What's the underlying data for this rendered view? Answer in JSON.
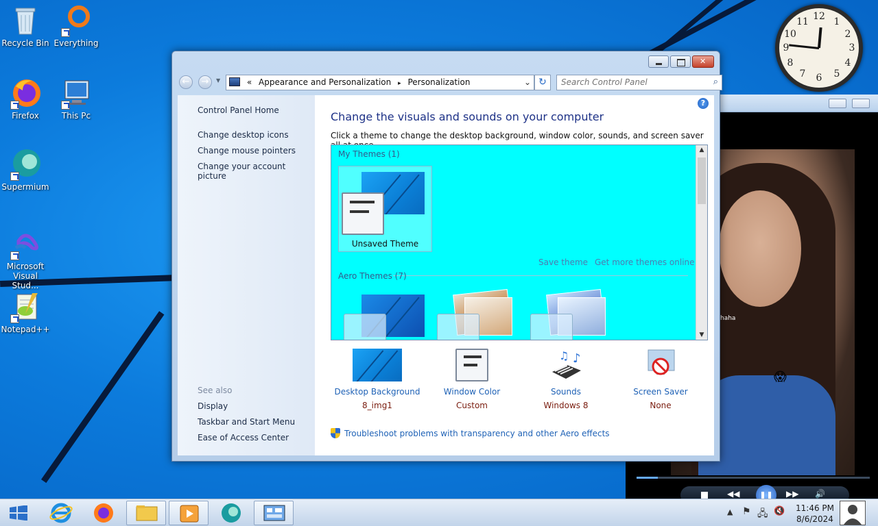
{
  "desktop": {
    "icons": [
      {
        "label": "Recycle Bin"
      },
      {
        "label": "Everything"
      },
      {
        "label": "Firefox"
      },
      {
        "label": "This Pc"
      },
      {
        "label": "Supermium"
      },
      {
        "label": "Microsoft Visual Stud..."
      },
      {
        "label": "Notepad++"
      }
    ]
  },
  "clock_gadget": {
    "numbers": [
      "12",
      "1",
      "2",
      "3",
      "4",
      "5",
      "6",
      "7",
      "8",
      "9",
      "10",
      "11"
    ]
  },
  "player": {
    "caption": "haha",
    "emoji": "😱",
    "progress_fraction": 0.09
  },
  "window": {
    "breadcrumb": {
      "prefix": "«",
      "items": [
        "Appearance and Personalization",
        "Personalization"
      ],
      "separator": "▸"
    },
    "search": {
      "placeholder": "Search Control Panel"
    },
    "left_nav": {
      "home": "Control Panel Home",
      "links": [
        "Change desktop icons",
        "Change mouse pointers",
        "Change your account picture"
      ],
      "see_also_label": "See also",
      "see_also": [
        "Display",
        "Taskbar and Start Menu",
        "Ease of Access Center"
      ]
    },
    "main": {
      "heading": "Change the visuals and sounds on your computer",
      "subheading": "Click a theme to change the desktop background, window color, sounds, and screen saver all at once.",
      "themes_bg_color": "#00ffff",
      "my_themes_label": "My Themes (1)",
      "unsaved_theme": "Unsaved Theme",
      "save_theme": "Save theme",
      "get_more_themes": "Get more themes online",
      "aero_themes_label": "Aero Themes (7)",
      "bottom": [
        {
          "title": "Desktop Background",
          "value": "8_img1",
          "icon": "desktop-background-icon"
        },
        {
          "title": "Window Color",
          "value": "Custom",
          "icon": "window-color-icon"
        },
        {
          "title": "Sounds",
          "value": "Windows 8",
          "icon": "sounds-icon"
        },
        {
          "title": "Screen Saver",
          "value": "None",
          "icon": "screen-saver-icon"
        }
      ],
      "troubleshoot": "Troubleshoot problems with transparency and other Aero effects"
    }
  },
  "taskbar": {
    "time": "11:46 PM",
    "date": "8/6/2024"
  }
}
